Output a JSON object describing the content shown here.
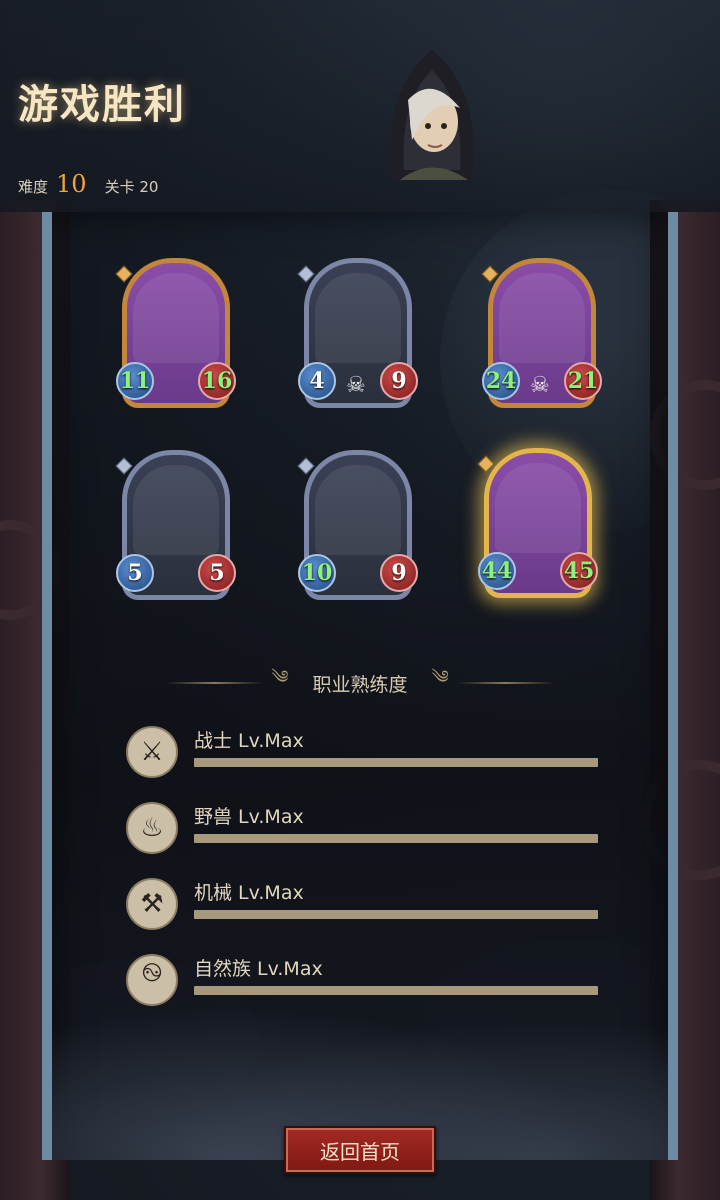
{
  "header": {
    "title": "游戏胜利",
    "difficulty_label": "难度",
    "difficulty_value": "10",
    "level_label": "关卡 20"
  },
  "cards": [
    {
      "attack": "11",
      "health": "16",
      "frame": "gold",
      "stat_buffed": true
    },
    {
      "attack": "4",
      "health": "9",
      "frame": "silver",
      "stat_buffed": false,
      "icon": "skull-icon"
    },
    {
      "attack": "24",
      "health": "21",
      "frame": "gold",
      "stat_buffed": true,
      "icon": "skull-icon"
    },
    {
      "attack": "5",
      "health": "5",
      "frame": "silver",
      "stat_buffed": false
    },
    {
      "attack": "10",
      "health": "9",
      "frame": "silver",
      "stat_buffed": true
    },
    {
      "attack": "44",
      "health": "45",
      "frame": "gold-glow",
      "stat_buffed": true
    }
  ],
  "mastery": {
    "section_title": "职业熟练度",
    "items": [
      {
        "label": "战士 Lv.Max",
        "icon": "sword-icon",
        "progress": 1.0
      },
      {
        "label": "野兽 Lv.Max",
        "icon": "flame-claw-icon",
        "progress": 1.0
      },
      {
        "label": "机械 Lv.Max",
        "icon": "wrench-icon",
        "progress": 1.0
      },
      {
        "label": "自然族 Lv.Max",
        "icon": "spiral-icon",
        "progress": 1.0
      }
    ]
  },
  "footer": {
    "return_label": "返回首页"
  },
  "colors": {
    "accent_orange": "#f2a33a",
    "attack_blue": "#3a6eb0",
    "health_red": "#b03030",
    "buff_green": "#8ff07a",
    "button_red": "#a52a25"
  }
}
